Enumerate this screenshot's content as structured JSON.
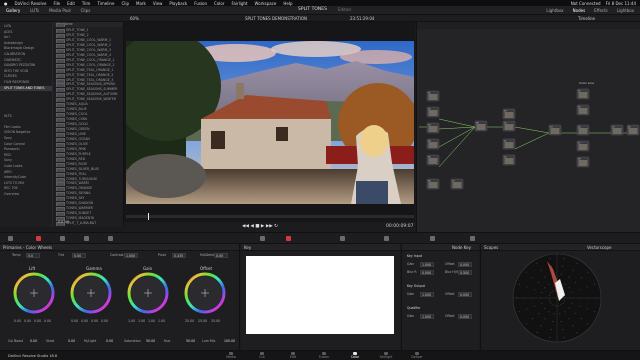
{
  "menubar": {
    "items": [
      "DaVinci Resolve",
      "File",
      "Edit",
      "Trim",
      "Timeline",
      "Clip",
      "Mark",
      "View",
      "Playback",
      "Fusion",
      "Color",
      "Fairlight",
      "Workspace",
      "Help"
    ],
    "right": [
      "Not Connected",
      "Fri 8 Dec 11:44"
    ]
  },
  "toolbar": {
    "left": [
      "Gallery",
      "LUTs",
      "Media Pool",
      "Clips"
    ],
    "project": "SPLIT TONES",
    "project_status": "Edited",
    "right": [
      "Lightbox",
      "Nodes",
      "Effects",
      "Lightbox"
    ]
  },
  "viewer_header": {
    "zoom": "60%",
    "clip": "SPLIT TONES DEMONSTRATION",
    "timecode": "23:51:29:04",
    "timeline": "Timeline"
  },
  "gallery": {
    "col1_items": [
      "LUTs",
      "ACES",
      "Arri",
      "Astrodesign",
      "Blackmagic Design",
      "CALIBRATION",
      "CINEMATIC",
      "SANDRO PEZZATINI",
      "INTO THE VOID",
      "CURVES",
      "FILM RESPONSE",
      "SPLIT TONES AND TONES",
      "",
      "",
      "",
      "",
      "HLTS",
      "",
      "Film Looks",
      "VISION Negative",
      "Sony",
      "Color Control",
      "Panasonic",
      "RED",
      "Sony",
      "Cube Looks",
      "ARRI",
      "IntensityCube",
      "LUTS TO MIX",
      "REC 709",
      "Overview"
    ],
    "col1_selected": 11,
    "header": "File Name",
    "col2_items": [
      "SPLIT_TONE_1",
      "SPLIT_TONE_2",
      "SPLIT_TONE_COOL_WARM_1",
      "SPLIT_TONE_COOL_WARM_2",
      "SPLIT_TONE_COOL_WARM_3",
      "SPLIT_TONE_COOL_WARM_4",
      "SPLIT_TONE_COOL_ORANGE_1",
      "SPLIT_TONE_COOL_ORANGE_2",
      "SPLIT_TONE_TEAL_ORANGE_1",
      "SPLIT_TONE_TEAL_ORANGE_2",
      "SPLIT_TONE_TEAL_ORANGE_3",
      "SPLIT_TONE_SEASONS_SPRING",
      "SPLIT_TONE_SEASONS_SUMMER",
      "SPLIT_TONE_SEASONS_AUTUMN",
      "SPLIT_TONE_SEASONS_WINTER",
      "TONES_AQUA",
      "TONES_BLUE",
      "TONES_COOL",
      "TONES_CYAN",
      "TONES_GOLD",
      "TONES_GREEN",
      "TONES_LIME",
      "TONES_OCEAN",
      "TONES_OLIVE",
      "TONES_PINK",
      "TONES_PURPLE",
      "TONES_RED",
      "TONES_ROSE",
      "TONES_SILVER_BLUE",
      "TONES_TEAL",
      "TONES_TURQUOISE",
      "TONES_WARM",
      "TONES_ORANGE",
      "TONES_SIENNA",
      "TONES_SKY",
      "TONES_SHADOW",
      "TONES_WARMER",
      "TONES_SUNSET",
      "TONES_MAGENTA",
      "SPLIT_T_LUMA.B&T"
    ],
    "size": "8.8 MB"
  },
  "transport": {
    "timecode": "00:00:09:07"
  },
  "node_editor": {
    "label": "Color Live",
    "nodes": [
      "01",
      "02",
      "03",
      "04",
      "05",
      "06",
      "07",
      "08",
      "09",
      "10",
      "11",
      "12",
      "13",
      "14",
      "15",
      "16",
      "17",
      "18",
      "19",
      "20"
    ]
  },
  "primaries": {
    "title": "Primaries - Color Wheels",
    "params": [
      {
        "label": "Temp",
        "value": "0.0"
      },
      {
        "label": "Tint",
        "value": "0.00"
      },
      {
        "label": "Contrast",
        "value": "1.000"
      },
      {
        "label": "Pivot",
        "value": "0.435"
      },
      {
        "label": "Md/Detail",
        "value": "0.00"
      }
    ],
    "wheels": [
      {
        "name": "Lift",
        "values": [
          "0.00",
          "0.00",
          "0.00",
          "0.00"
        ]
      },
      {
        "name": "Gamma",
        "values": [
          "0.00",
          "0.00",
          "0.00",
          "0.00"
        ]
      },
      {
        "name": "Gain",
        "values": [
          "1.00",
          "1.00",
          "1.00",
          "1.00"
        ]
      },
      {
        "name": "Offset",
        "values": [
          "25.00",
          "25.00",
          "25.00"
        ]
      }
    ],
    "bottom": [
      {
        "label": "Col Boost",
        "value": "0.00"
      },
      {
        "label": "Shad",
        "value": "0.00"
      },
      {
        "label": "Hi/Light",
        "value": "0.00"
      },
      {
        "label": "Saturation",
        "value": "50.00"
      },
      {
        "label": "Hue",
        "value": "50.00"
      },
      {
        "label": "Lum Mix",
        "value": "100.00"
      }
    ]
  },
  "key_panel": {
    "title": "Key"
  },
  "key_controls": {
    "title": "Node Key",
    "sections": [
      {
        "name": "Key Input",
        "params": [
          {
            "label": "Gain",
            "value": "1.000"
          },
          {
            "label": "Offset",
            "value": "0.000"
          },
          {
            "label": "Blur R",
            "value": "0.000"
          },
          {
            "label": "Blur H/V",
            "value": "0.500"
          }
        ]
      },
      {
        "name": "Key Output",
        "params": [
          {
            "label": "Gain",
            "value": "1.000"
          },
          {
            "label": "Offset",
            "value": "0.000"
          }
        ]
      },
      {
        "name": "Qualifier",
        "params": [
          {
            "label": "Gain",
            "value": "1.000"
          },
          {
            "label": "Offset",
            "value": "0.000"
          }
        ]
      }
    ]
  },
  "scopes": {
    "title": "Scopes",
    "mode": "Vectorscope"
  },
  "pages": {
    "items": [
      "Media",
      "Cut",
      "Edit",
      "Fusion",
      "Color",
      "Fairlight",
      "Deliver"
    ],
    "active": "Color"
  },
  "status": {
    "app": "DaVinci Resolve Studio 18.6"
  },
  "colors": {
    "accent": "#d9363e",
    "panel": "#1e1e21",
    "node_bg": "#242427"
  }
}
